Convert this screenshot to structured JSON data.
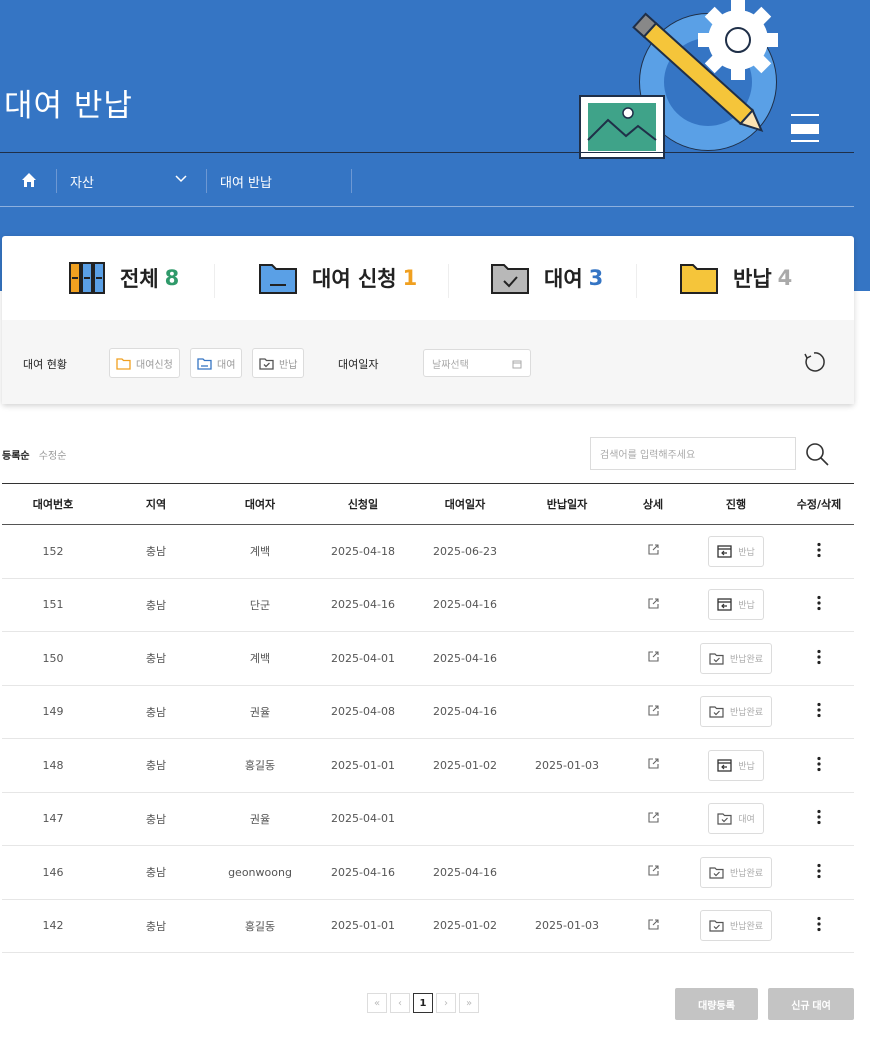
{
  "header": {
    "title": "대여 반납",
    "breadcrumb": {
      "level1": "자산",
      "level2": "대여 반납"
    }
  },
  "summary": {
    "total": {
      "label": "전체",
      "count": "8",
      "color": "#2f9a6a"
    },
    "request": {
      "label": "대여 신청",
      "count": "1",
      "color": "#f0a020"
    },
    "rented": {
      "label": "대여",
      "count": "3",
      "color": "#3575c4"
    },
    "returned": {
      "label": "반납",
      "count": "4",
      "color": "#aaaaaa"
    }
  },
  "filters": {
    "status_label": "대여 현황",
    "chips": [
      "대여신청",
      "대여",
      "반납"
    ],
    "date_label": "대여일자",
    "date_placeholder": "날짜선택"
  },
  "sort": {
    "active": "등록순",
    "inactive": "수정순"
  },
  "search": {
    "placeholder": "검색어를 입력해주세요"
  },
  "table": {
    "columns": [
      "대여번호",
      "지역",
      "대여자",
      "신청일",
      "대여일자",
      "반납일자",
      "상세",
      "진행",
      "수정/삭제"
    ],
    "rows": [
      {
        "id": "152",
        "region": "충남",
        "renter": "계백",
        "applied": "2025-04-18",
        "rent_date": "2025-06-23",
        "return_date": "",
        "status": "반납",
        "status_icon": "return-box-icon"
      },
      {
        "id": "151",
        "region": "충남",
        "renter": "단군",
        "applied": "2025-04-16",
        "rent_date": "2025-04-16",
        "return_date": "",
        "status": "반납",
        "status_icon": "return-box-icon"
      },
      {
        "id": "150",
        "region": "충남",
        "renter": "계백",
        "applied": "2025-04-01",
        "rent_date": "2025-04-16",
        "return_date": "",
        "status": "반납완료",
        "status_icon": "folder-check-icon"
      },
      {
        "id": "149",
        "region": "충남",
        "renter": "권율",
        "applied": "2025-04-08",
        "rent_date": "2025-04-16",
        "return_date": "",
        "status": "반납완료",
        "status_icon": "folder-check-icon"
      },
      {
        "id": "148",
        "region": "충남",
        "renter": "홍길동",
        "applied": "2025-01-01",
        "rent_date": "2025-01-02",
        "return_date": "2025-01-03",
        "status": "반납",
        "status_icon": "return-box-icon"
      },
      {
        "id": "147",
        "region": "충남",
        "renter": "권율",
        "applied": "2025-04-01",
        "rent_date": "",
        "return_date": "",
        "status": "대여",
        "status_icon": "folder-check-icon"
      },
      {
        "id": "146",
        "region": "충남",
        "renter": "geonwoong",
        "applied": "2025-04-16",
        "rent_date": "2025-04-16",
        "return_date": "",
        "status": "반납완료",
        "status_icon": "folder-check-icon"
      },
      {
        "id": "142",
        "region": "충남",
        "renter": "홍길동",
        "applied": "2025-01-01",
        "rent_date": "2025-01-02",
        "return_date": "2025-01-03",
        "status": "반납완료",
        "status_icon": "folder-check-icon"
      }
    ]
  },
  "pagination": {
    "current": "1",
    "first": "«",
    "prev": "‹",
    "next": "›",
    "last": "»"
  },
  "actions": {
    "bulk": "대량등록",
    "new": "신규 대여"
  }
}
